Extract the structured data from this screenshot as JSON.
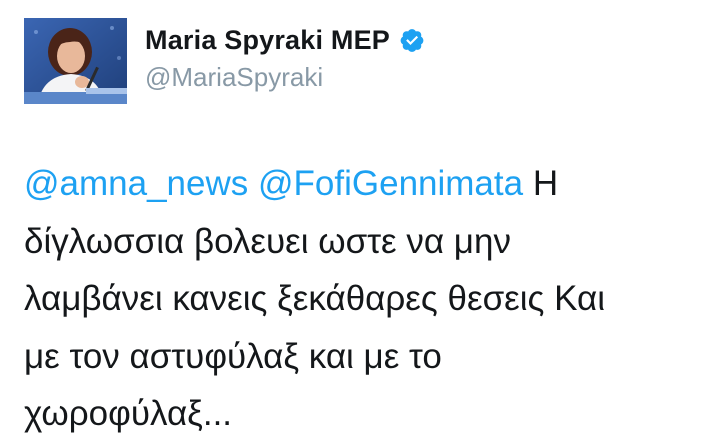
{
  "author": {
    "display_name": "Maria Spyraki MEP",
    "handle": "@MariaSpyraki",
    "verified": true,
    "avatar_icon": "profile-photo"
  },
  "tweet": {
    "mentions": [
      "@amna_news",
      "@FofiGennimata"
    ],
    "line1_rest": "Η",
    "line2": "δίγλωσσια βολευει ωστε να μην",
    "line3": "λαμβάνει κανεις ξεκάθαρες θεσεις Και",
    "line4": "με τον αστυφύλαξ και με το",
    "line5": "χωροφύλαξ..."
  },
  "colors": {
    "link": "#1da1f2",
    "verified_badge": "#1da1f2",
    "handle": "#8899a6",
    "text": "#14171a"
  }
}
